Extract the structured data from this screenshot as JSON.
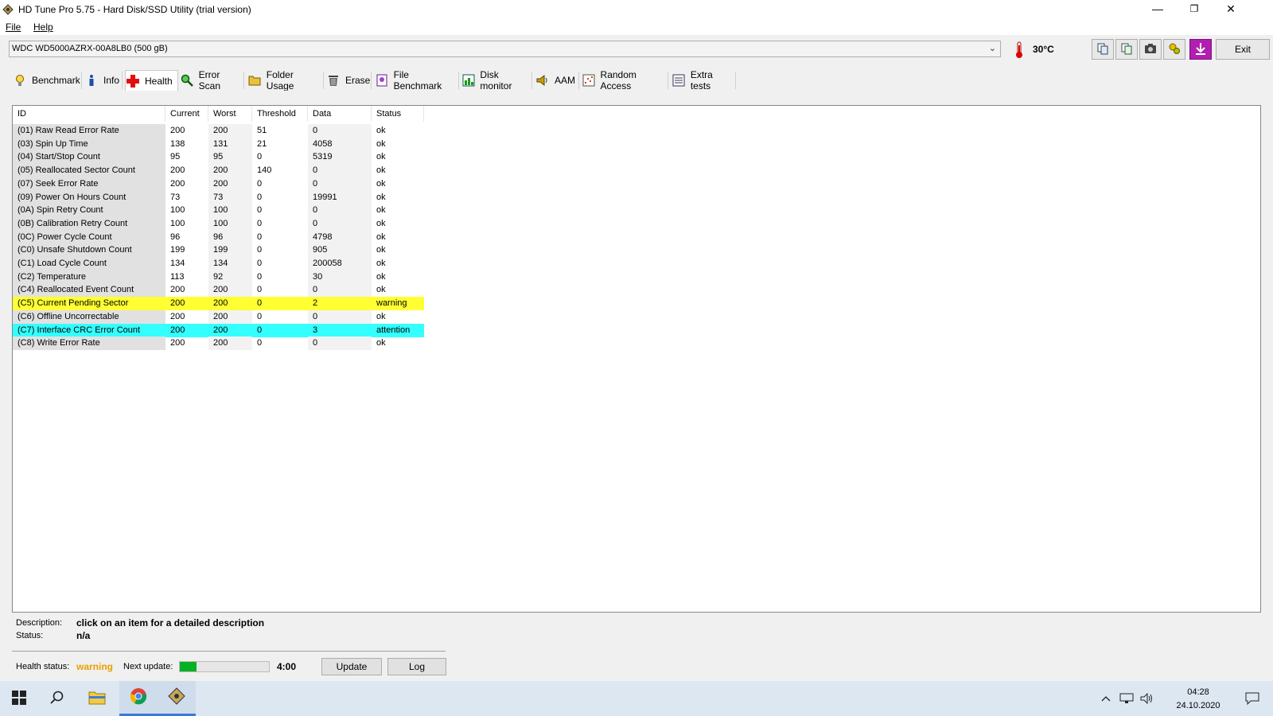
{
  "window": {
    "title": "HD Tune Pro 5.75 - Hard Disk/SSD Utility (trial version)",
    "minimize_glyph": "—",
    "restore_glyph": "❐",
    "close_glyph": "✕"
  },
  "menu": {
    "file": "File",
    "help": "Help"
  },
  "toolbar": {
    "drive": "WDC WD5000AZRX-00A8LB0 (500 gB)",
    "temperature": "30°C",
    "exit_label": "Exit"
  },
  "tabs": [
    {
      "label": "Benchmark",
      "icon": "benchmark-icon"
    },
    {
      "label": "Info",
      "icon": "info-icon"
    },
    {
      "label": "Health",
      "icon": "health-icon"
    },
    {
      "label": "Error Scan",
      "icon": "error-scan-icon"
    },
    {
      "label": "Folder Usage",
      "icon": "folder-icon"
    },
    {
      "label": "Erase",
      "icon": "erase-icon"
    },
    {
      "label": "File Benchmark",
      "icon": "file-benchmark-icon"
    },
    {
      "label": "Disk monitor",
      "icon": "disk-monitor-icon"
    },
    {
      "label": "AAM",
      "icon": "speaker-icon"
    },
    {
      "label": "Random Access",
      "icon": "random-access-icon"
    },
    {
      "label": "Extra tests",
      "icon": "extra-tests-icon"
    }
  ],
  "active_tab": "Health",
  "smart": {
    "columns": [
      "ID",
      "Current",
      "Worst",
      "Threshold",
      "Data",
      "Status"
    ],
    "rows": [
      {
        "id": "(01) Raw Read Error Rate",
        "current": "200",
        "worst": "200",
        "threshold": "51",
        "data": "0",
        "status": "ok"
      },
      {
        "id": "(03) Spin Up Time",
        "current": "138",
        "worst": "131",
        "threshold": "21",
        "data": "4058",
        "status": "ok"
      },
      {
        "id": "(04) Start/Stop Count",
        "current": "95",
        "worst": "95",
        "threshold": "0",
        "data": "5319",
        "status": "ok"
      },
      {
        "id": "(05) Reallocated Sector Count",
        "current": "200",
        "worst": "200",
        "threshold": "140",
        "data": "0",
        "status": "ok"
      },
      {
        "id": "(07) Seek Error Rate",
        "current": "200",
        "worst": "200",
        "threshold": "0",
        "data": "0",
        "status": "ok"
      },
      {
        "id": "(09) Power On Hours Count",
        "current": "73",
        "worst": "73",
        "threshold": "0",
        "data": "19991",
        "status": "ok"
      },
      {
        "id": "(0A) Spin Retry Count",
        "current": "100",
        "worst": "100",
        "threshold": "0",
        "data": "0",
        "status": "ok"
      },
      {
        "id": "(0B) Calibration Retry Count",
        "current": "100",
        "worst": "100",
        "threshold": "0",
        "data": "0",
        "status": "ok"
      },
      {
        "id": "(0C) Power Cycle Count",
        "current": "96",
        "worst": "96",
        "threshold": "0",
        "data": "4798",
        "status": "ok"
      },
      {
        "id": "(C0) Unsafe Shutdown Count",
        "current": "199",
        "worst": "199",
        "threshold": "0",
        "data": "905",
        "status": "ok"
      },
      {
        "id": "(C1) Load Cycle Count",
        "current": "134",
        "worst": "134",
        "threshold": "0",
        "data": "200058",
        "status": "ok"
      },
      {
        "id": "(C2) Temperature",
        "current": "113",
        "worst": "92",
        "threshold": "0",
        "data": "30",
        "status": "ok"
      },
      {
        "id": "(C4) Reallocated Event Count",
        "current": "200",
        "worst": "200",
        "threshold": "0",
        "data": "0",
        "status": "ok"
      },
      {
        "id": "(C5) Current Pending Sector",
        "current": "200",
        "worst": "200",
        "threshold": "0",
        "data": "2",
        "status": "warning"
      },
      {
        "id": "(C6) Offline Uncorrectable",
        "current": "200",
        "worst": "200",
        "threshold": "0",
        "data": "0",
        "status": "ok"
      },
      {
        "id": "(C7) Interface CRC Error Count",
        "current": "200",
        "worst": "200",
        "threshold": "0",
        "data": "3",
        "status": "attention"
      },
      {
        "id": "(C8) Write Error Rate",
        "current": "200",
        "worst": "200",
        "threshold": "0",
        "data": "0",
        "status": "ok"
      }
    ]
  },
  "details": {
    "description_label": "Description:",
    "description": "click on an item for a detailed description",
    "status_label": "Status:",
    "status": "n/a"
  },
  "footer": {
    "health_label": "Health status:",
    "health_value": "warning",
    "next_update_label": "Next update:",
    "next_update_progress": 0.19,
    "next_update_time": "4:00",
    "update_label": "Update",
    "log_label": "Log"
  },
  "colors": {
    "warning_row": "#ffff33",
    "attention_row": "#33ffff",
    "health_warning_text": "#e8a000",
    "progress": "#06b025"
  },
  "taskbar": {
    "time": "04:28",
    "date": "24.10.2020"
  }
}
